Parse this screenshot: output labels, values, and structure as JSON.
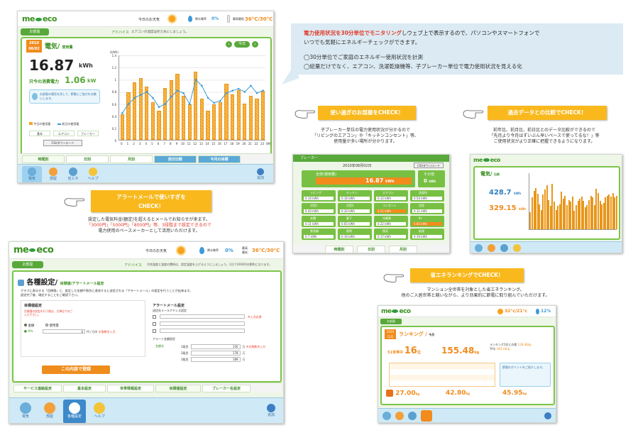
{
  "screen1": {
    "logo": "me eco",
    "weather_label": "今日のお天気",
    "precip_label": "降水確率",
    "precip_value": "0%",
    "temp_label": "最高最低",
    "temp_value": "36°C/30°C",
    "home_tab": "お部屋",
    "advice_label": "アドバイス",
    "advice_text": "エアコンの温度は控えめにしましょう。",
    "date_badge": "2010 08/02",
    "power_title": "電気/",
    "power_sub": "使用量",
    "power_value": "16.87",
    "power_unit": "kWh",
    "current_label": "只今の消費電力",
    "current_value": "1.06",
    "current_unit": "kW",
    "tip_text": "お部屋の電気を消して、節電にご協力をお願いします。",
    "legend_today": "今日の使用量",
    "legend_prev": "前日の使用量",
    "legend_btn1": "基本",
    "legend_btn2": "エアコン",
    "legend_btn3": "ブレーカー",
    "csv_button": "CSVダウンロード",
    "today_button": "今日",
    "y_ticks": [
      "1.4",
      "1.2",
      "1",
      "0.8",
      "0.6",
      "0.4",
      "0.2",
      "0"
    ],
    "y_axis_unit": "(kWh)",
    "x_unit": "(時)",
    "bottom_tabs": [
      "時間別",
      "日別",
      "月別",
      "前日比較",
      "今月の目標"
    ],
    "nav_items": [
      "電気",
      "部屋",
      "省エネ",
      "ヘルプ",
      "追加"
    ]
  },
  "chart_data": {
    "type": "bar",
    "categories": [
      "0",
      "1",
      "2",
      "3",
      "4",
      "5",
      "6",
      "7",
      "8",
      "9",
      "10",
      "11",
      "12",
      "13",
      "14",
      "15",
      "16",
      "17",
      "18",
      "19",
      "20",
      "21",
      "22",
      "23"
    ],
    "series": [
      {
        "name": "今日の使用量",
        "values": [
          0.42,
          0.78,
          0.95,
          1.02,
          0.88,
          0.62,
          0.48,
          0.85,
          0.98,
          1.08,
          0.72,
          0.58,
          1.12,
          0.68,
          0.48,
          0.58,
          0.62,
          0.92,
          0.75,
          0.82,
          0.6,
          0.72,
          0.68,
          0.8
        ]
      },
      {
        "name": "前日の使用量",
        "values": [
          0.45,
          0.6,
          0.7,
          0.75,
          0.8,
          0.7,
          0.55,
          0.6,
          0.72,
          0.82,
          0.78,
          0.6,
          1.0,
          0.9,
          0.7,
          0.62,
          0.65,
          0.78,
          0.82,
          0.85,
          0.8,
          0.9,
          0.78,
          0.82
        ]
      }
    ],
    "ylim": [
      0,
      1.4
    ]
  },
  "top_callout": {
    "line1_red": "電力使用状況を30分単位でモニタリング",
    "line1_rest": "しウェブ上で表示するので、パソコンやスマートフォンで",
    "line2": "いつでも気軽にエネルギーチェックができます。",
    "bullet1": "◯30分単位でご家庭のエネルギー使用状況を計測",
    "bullet2": "◯総量だけでなく、エアコン、洗濯乾燥機等、子ブレーカー単位で電力使用状況を見える化"
  },
  "callout_rooms": {
    "title": "使い過ぎのお部屋をCHECK！",
    "desc1": "子ブレーカー単位の電力使用状況が分かるので",
    "desc2": "「リビングのエアコン」や「キッチンコンセント」等、",
    "desc3": "使用量が多い場所が分かります。"
  },
  "callout_past": {
    "title": "過去データとの比較でCHECK！",
    "desc1": "前年比、前月比、前日比とのデータ比較ができるので",
    "desc2": "「先月より今月はずいぶん早いペースで使ってるな！」等",
    "desc3": "ご使用状況がより正確に把握できるようになります。"
  },
  "callout_alert": {
    "title1": "アラートメールで使いすぎを",
    "title2": "CHECK！",
    "desc1": "設定した電気料金(額定)を超えるとメールでお知らせが来ます。",
    "desc2": "「3000円」「5000円」「8000円」等、3段階まで設定できるので",
    "desc3": "電力使用のペースメーカーとして活用いただけます。"
  },
  "callout_rank": {
    "title": "省エネランキングでCHECK！",
    "desc1": "マンション全世帯を対象とした省エネランキング。",
    "desc2": "他のご入居世帯と競いながら、より効果的に節電に取り組んでいただけます。"
  },
  "breaker": {
    "title": "ブレーカー",
    "date": "2010年08月02日",
    "csv": "CSVダウンロード",
    "total_label": "全体(使用量)",
    "total_value": "16.87",
    "total_unit": "kWh",
    "other_label": "その他",
    "other_value": "0",
    "other_unit": "kWh",
    "cells": [
      {
        "label": "リビング",
        "value": "0.14 kWh"
      },
      {
        "label": "キッチン",
        "value": "0.16 kWh"
      },
      {
        "label": "エアコン",
        "value": "0.12 kWh"
      },
      {
        "label": "洗面所",
        "value": "0.54 kWh"
      },
      {
        "label": "洋室1",
        "value": "0.44 kWh"
      },
      {
        "label": "洋室2",
        "value": "0.34 kWh"
      },
      {
        "label": "コンセント",
        "value": "4.21 kWh"
      },
      {
        "label": "浴室",
        "value": "0.11 kWh"
      },
      {
        "label": "玄関",
        "value": "0.11 kWh"
      },
      {
        "label": "廊下",
        "value": "0.65 kWh"
      },
      {
        "label": "冷蔵庫",
        "value": "0.22 kWh"
      },
      {
        "label": "IH",
        "value": "5.65 kWh"
      },
      {
        "label": "食洗機",
        "value": "0.7 kWh"
      },
      {
        "label": "照明",
        "value": "0.16 kWh"
      },
      {
        "label": "換気",
        "value": "0.17 kWh"
      },
      {
        "label": "給湯",
        "value": "0.19 kWh"
      }
    ],
    "tabs": [
      "時間別",
      "日別",
      "月別"
    ]
  },
  "past": {
    "logo": "me eco",
    "title": "電気/",
    "sub": "比較",
    "value1": "428.7",
    "value2": "329.15",
    "unit": "kWh"
  },
  "screen2": {
    "logo": "me eco",
    "weather_label": "今日のお天気",
    "precip_label": "降水確率",
    "precip_value": "0%",
    "temp_label": "最高最低",
    "temp_value": "36°C/30°C",
    "home_tab": "お部屋",
    "advice_label": "アドバイス",
    "advice_text": "冷房温度と湿度の関係は、設定温度を上げるようにしましょう。1日で1000円の節約になります。",
    "settings_title": "各種設定/",
    "settings_sub": "目標値/アラートメール設定",
    "intro1": "グラフに表示する「目標値」と、設定した金額や割合に達成すると送信される「アラートメール」の設定を行うことが出来ます。",
    "intro2": "設定完了後、確定することをご確認下さい。",
    "goal_label": "目標値設定",
    "goal_note": "目標値の設定を行う際は、月単位でのご入力下さい。",
    "radio1": "金額",
    "radio2": "使用量",
    "goal_value": "0",
    "goal_unit": "円 / 月※",
    "goal_example": "半角数字入力",
    "alert_label": "アラートメール設定",
    "alert_sub": "送信先メールアドレス設定",
    "alert_required": "※入力必須",
    "level_label": "アラート金額設定",
    "level_title": "金額名",
    "levels": [
      {
        "name": "1段目",
        "value": "150",
        "unit": "万"
      },
      {
        "name": "2段目",
        "value": "178",
        "unit": "万"
      },
      {
        "name": "3段目",
        "value": "189",
        "unit": "万"
      }
    ],
    "level_note": "※半角数字入力",
    "submit": "この内容で登録",
    "tabs": [
      "サービス連絡設定",
      "基本設定",
      "世帯情報設定",
      "目標値設定",
      "ブレーカー名設定"
    ],
    "nav_items": [
      "電気",
      "部屋",
      "各種設定",
      "ヘルプ",
      "追加"
    ]
  },
  "rank": {
    "logo": "me eco",
    "temp": "32°c/21°c",
    "precip": "12%",
    "tab": "お部屋",
    "month": "2010 12月",
    "title": "ランキング /",
    "sub": "今月",
    "rank_label": "51世帯中",
    "rank_value": "16",
    "rank_unit": "位",
    "value": "155.48",
    "value_unit": "kg",
    "avg_label": "ランキング1位との差",
    "avg_value": "128.48kg",
    "avg2_label": "平均",
    "avg2_value": "340.33kg",
    "tip": "節電のポイントをご紹介します。",
    "podium1": "27.00",
    "podium2": "42.80",
    "podium3": "45.95",
    "podium_unit": "kg"
  }
}
